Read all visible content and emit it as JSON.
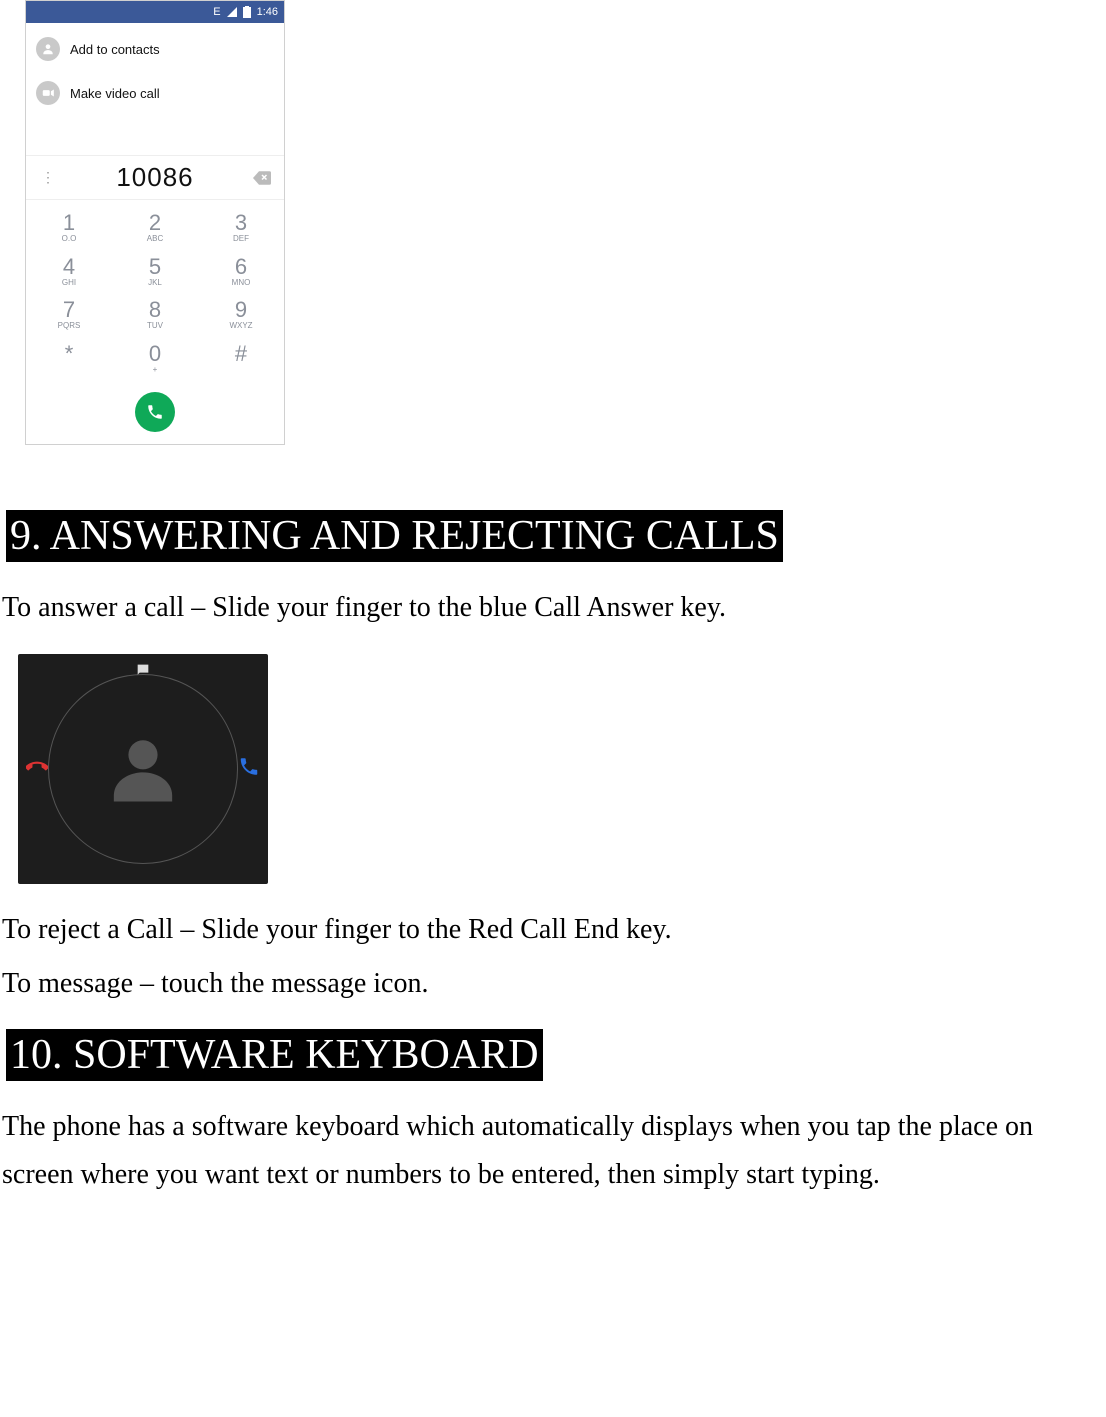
{
  "phone": {
    "status_bar": {
      "network": "E",
      "battery_icon": "battery-icon",
      "time": "1:46"
    },
    "actions": [
      {
        "icon": "person-icon",
        "label": "Add to contacts"
      },
      {
        "icon": "video-icon",
        "label": "Make video call"
      }
    ],
    "entered_number": "10086",
    "keypad": [
      {
        "digit": "1",
        "sub": "O.O"
      },
      {
        "digit": "2",
        "sub": "ABC"
      },
      {
        "digit": "3",
        "sub": "DEF"
      },
      {
        "digit": "4",
        "sub": "GHI"
      },
      {
        "digit": "5",
        "sub": "JKL"
      },
      {
        "digit": "6",
        "sub": "MNO"
      },
      {
        "digit": "7",
        "sub": "PQRS"
      },
      {
        "digit": "8",
        "sub": "TUV"
      },
      {
        "digit": "9",
        "sub": "WXYZ"
      },
      {
        "digit": "*",
        "sub": ""
      },
      {
        "digit": "0",
        "sub": "+"
      },
      {
        "digit": "#",
        "sub": ""
      }
    ]
  },
  "headings": {
    "section9": "9. ANSWERING AND REJECTING CALLS",
    "section10": "10. SOFTWARE KEYBOARD"
  },
  "paragraphs": {
    "answer": "To answer a call – Slide your finger to the blue Call Answer key.",
    "reject": "To reject a Call – Slide your finger to the Red Call End key.",
    "message": "To message – touch the message icon.",
    "keyboard": "The phone has a software keyboard which automatically displays when you tap the place on screen where you want text or numbers to be entered, then simply start typing."
  }
}
